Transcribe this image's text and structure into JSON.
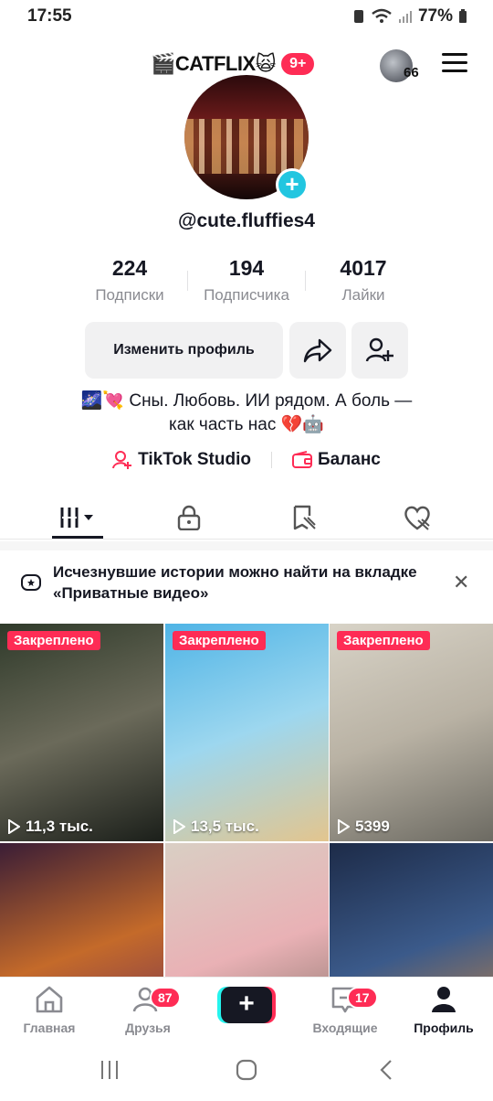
{
  "status_bar": {
    "time": "17:55",
    "battery": "77%"
  },
  "header": {
    "title": "🎬CATFLIX🙀",
    "notif_count": "9+",
    "friends_count": "66"
  },
  "profile": {
    "username": "@cute.fluffies4",
    "stats": [
      {
        "value": "224",
        "label": "Подписки"
      },
      {
        "value": "194",
        "label": "Подписчика"
      },
      {
        "value": "4017",
        "label": "Лайки"
      }
    ],
    "edit_button": "Изменить профиль",
    "bio_line1": "🌌💘 Сны. Любовь. ИИ рядом. А боль —",
    "bio_line2": "как часть нас 💔🤖",
    "studio_label": "TikTok Studio",
    "balance_label": "Баланс"
  },
  "banner": {
    "text": "Исчезнувшие истории можно найти на вкладке «Приватные видео»"
  },
  "videos": [
    {
      "pinned": "Закреплено",
      "views": "11,3 тыс.",
      "colors": [
        "#2f3a2a",
        "#6b6a5a",
        "#1b1f1a"
      ]
    },
    {
      "pinned": "Закреплено",
      "views": "13,5 тыс.",
      "colors": [
        "#4fb4e6",
        "#9dd7ef",
        "#e3c58e"
      ]
    },
    {
      "pinned": "Закреплено",
      "views": "5399",
      "colors": [
        "#d8d3c7",
        "#b9b2a4",
        "#6c6a62"
      ]
    },
    {
      "pinned": "",
      "views": "",
      "colors": [
        "#3a1d36",
        "#c46a2a",
        "#6a2b5a"
      ]
    },
    {
      "pinned": "",
      "views": "",
      "colors": [
        "#d9cfc4",
        "#e9b1b5",
        "#7a6b60"
      ]
    },
    {
      "pinned": "",
      "views": "",
      "colors": [
        "#1d2b48",
        "#3b5a8a",
        "#d88a3a"
      ]
    }
  ],
  "bottom_nav": {
    "home": "Главная",
    "friends": "Друзья",
    "friends_badge": "87",
    "inbox": "Входящие",
    "inbox_badge": "17",
    "profile": "Профиль"
  },
  "colors": {
    "accent": "#fe2c55",
    "cyan": "#25f4ee",
    "text": "#161823",
    "muted": "#8a8b91"
  }
}
